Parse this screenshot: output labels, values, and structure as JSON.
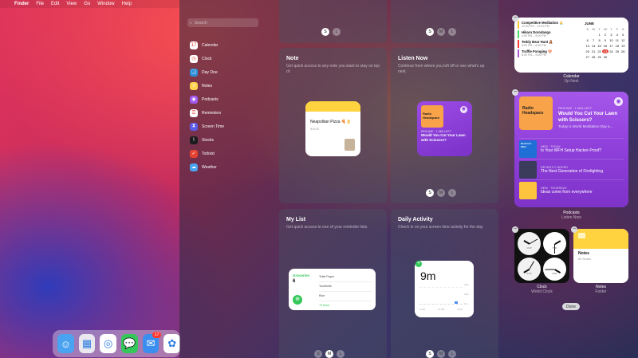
{
  "menubar": {
    "app": "Finder",
    "items": [
      "File",
      "Edit",
      "View",
      "Go",
      "Window",
      "Help"
    ]
  },
  "search": {
    "placeholder": "Search"
  },
  "sidebar": {
    "items": [
      {
        "label": "Calendar",
        "icon": "calendar-icon",
        "color": "#ffffff",
        "glyph": "17"
      },
      {
        "label": "Clock",
        "icon": "clock-icon",
        "color": "#ffffff",
        "glyph": "◷"
      },
      {
        "label": "Day One",
        "icon": "day-one-icon",
        "color": "#2d8fd5",
        "glyph": "❏"
      },
      {
        "label": "Notes",
        "icon": "notes-icon",
        "color": "#ffd34d",
        "glyph": "≡"
      },
      {
        "label": "Podcasts",
        "icon": "podcasts-icon",
        "color": "#a25af0",
        "glyph": "◉"
      },
      {
        "label": "Reminders",
        "icon": "reminders-icon",
        "color": "#ffffff",
        "glyph": "☰"
      },
      {
        "label": "Screen Time",
        "icon": "screen-time-icon",
        "color": "#5e5ce6",
        "glyph": "⧗"
      },
      {
        "label": "Stocks",
        "icon": "stocks-icon",
        "color": "#1c1c1e",
        "glyph": "⌇"
      },
      {
        "label": "Todoist",
        "icon": "todoist-icon",
        "color": "#e44332",
        "glyph": "✓"
      },
      {
        "label": "Weather",
        "icon": "weather-icon",
        "color": "#4aa3f0",
        "glyph": "☁"
      }
    ]
  },
  "panels": {
    "topleft": {
      "sizes": [
        "S",
        "L"
      ]
    },
    "topright": {
      "sizes": [
        "S",
        "M",
        "L"
      ]
    },
    "note": {
      "title": "Note",
      "desc": "Get quick access to any note you want to stay on top of.",
      "note_title": "Neapolitan Pizza 🍕👌",
      "note_date": "9/4/20"
    },
    "listen": {
      "title": "Listen Now",
      "desc": "Continue from where you left off or see what's up next.",
      "art_title": "Radio Headspace",
      "resume": "RESUME · 1 MIN LEFT",
      "episode": "Would You Cut Your Lawn with Scissors?",
      "sizes": [
        "S",
        "M",
        "L"
      ]
    },
    "mylist": {
      "title": "My List",
      "desc": "Get quick access to one of your reminder lists.",
      "list_name": "Groceries",
      "count": "6",
      "items": [
        "Toilet Paper",
        "Toothbrite",
        "Rice",
        "+5 More"
      ]
    },
    "activity": {
      "title": "Daily Activity",
      "desc": "Check in on your screen time activity for the day.",
      "time": "9m",
      "ticks": [
        "6 AM",
        "12 PM",
        "6 PM"
      ],
      "axis": [
        "60m",
        "30m",
        "0m"
      ],
      "sizes": [
        "S",
        "M",
        "L"
      ]
    }
  },
  "calendar": {
    "month": "JUNE",
    "dow": [
      "S",
      "M",
      "T",
      "W",
      "T",
      "F",
      "S"
    ],
    "days": [
      "",
      "",
      "1",
      "2",
      "3",
      "4",
      "5",
      "6",
      "7",
      "8",
      "9",
      "10",
      "11",
      "12",
      "13",
      "14",
      "15",
      "16",
      "17",
      "18",
      "19",
      "20",
      "21",
      "22",
      "23",
      "24",
      "25",
      "26",
      "27",
      "28",
      "29",
      "30",
      "",
      "",
      ""
    ],
    "today": "23",
    "accent": "#e33b2f",
    "events": [
      {
        "title": "Competitive Meditation 🙏",
        "time": "12:00 PM – 12:30 PM",
        "color": "#f8c441"
      },
      {
        "title": "Hikaru Dorodango",
        "time": "4:00 PM – 5:00 PM",
        "color": "#4cd964"
      },
      {
        "title": "Teddy Bear Hunt 🧸",
        "time": "6:00 PM – 6:30 PM",
        "color": "#ff3b30"
      },
      {
        "title": "Truffle Foraging 🍄",
        "time": "8:00 PM – 9:00 PM",
        "color": "#af52de"
      }
    ],
    "label": "Calendar",
    "sub": "Up Next"
  },
  "podcasts": {
    "art_title": "Radio Headspace",
    "resume": "RESUME · 1 MIN LEFT",
    "title": "Would You Cut Your Lawn with Scissors?",
    "desc": "Today is World Meditation Day a…",
    "rows": [
      {
        "meta": "NEW · TODAY",
        "title": "Is Your WFH Setup Hacker-Proof?",
        "art": "Business Wars",
        "color": "#1f6fd6"
      },
      {
        "meta": "RECENTLY ADDED",
        "title": "The Next Generation of Firefighting",
        "art": "",
        "color": "#3b3b5c"
      },
      {
        "meta": "NEW · THURSDAY",
        "title": "Ideas come from everywhere",
        "art": "",
        "color": "#ffc43d"
      }
    ],
    "label": "Podcasts",
    "sub": "Listen Now"
  },
  "clock": {
    "label": "Clock",
    "sub": "World Clock",
    "cities": [
      "CUP",
      "TOK",
      "SYD",
      "PAR"
    ]
  },
  "notes": {
    "label": "Notes",
    "sub": "Folder",
    "title": "Notes",
    "count": "60 Notes"
  },
  "done": "Done",
  "dock": [
    {
      "icon": "finder-icon",
      "color": "#4aa3f0",
      "glyph": "☺"
    },
    {
      "icon": "launchpad-icon",
      "color": "#e8e8ee",
      "glyph": "▦"
    },
    {
      "icon": "safari-icon",
      "color": "#ffffff",
      "glyph": "◎"
    },
    {
      "icon": "messages-icon",
      "color": "#34c759",
      "glyph": "💬"
    },
    {
      "icon": "mail-icon",
      "color": "#3a8ef0",
      "glyph": "✉",
      "badge": "17"
    },
    {
      "icon": "photos-icon",
      "color": "#ffffff",
      "glyph": "✿"
    }
  ]
}
